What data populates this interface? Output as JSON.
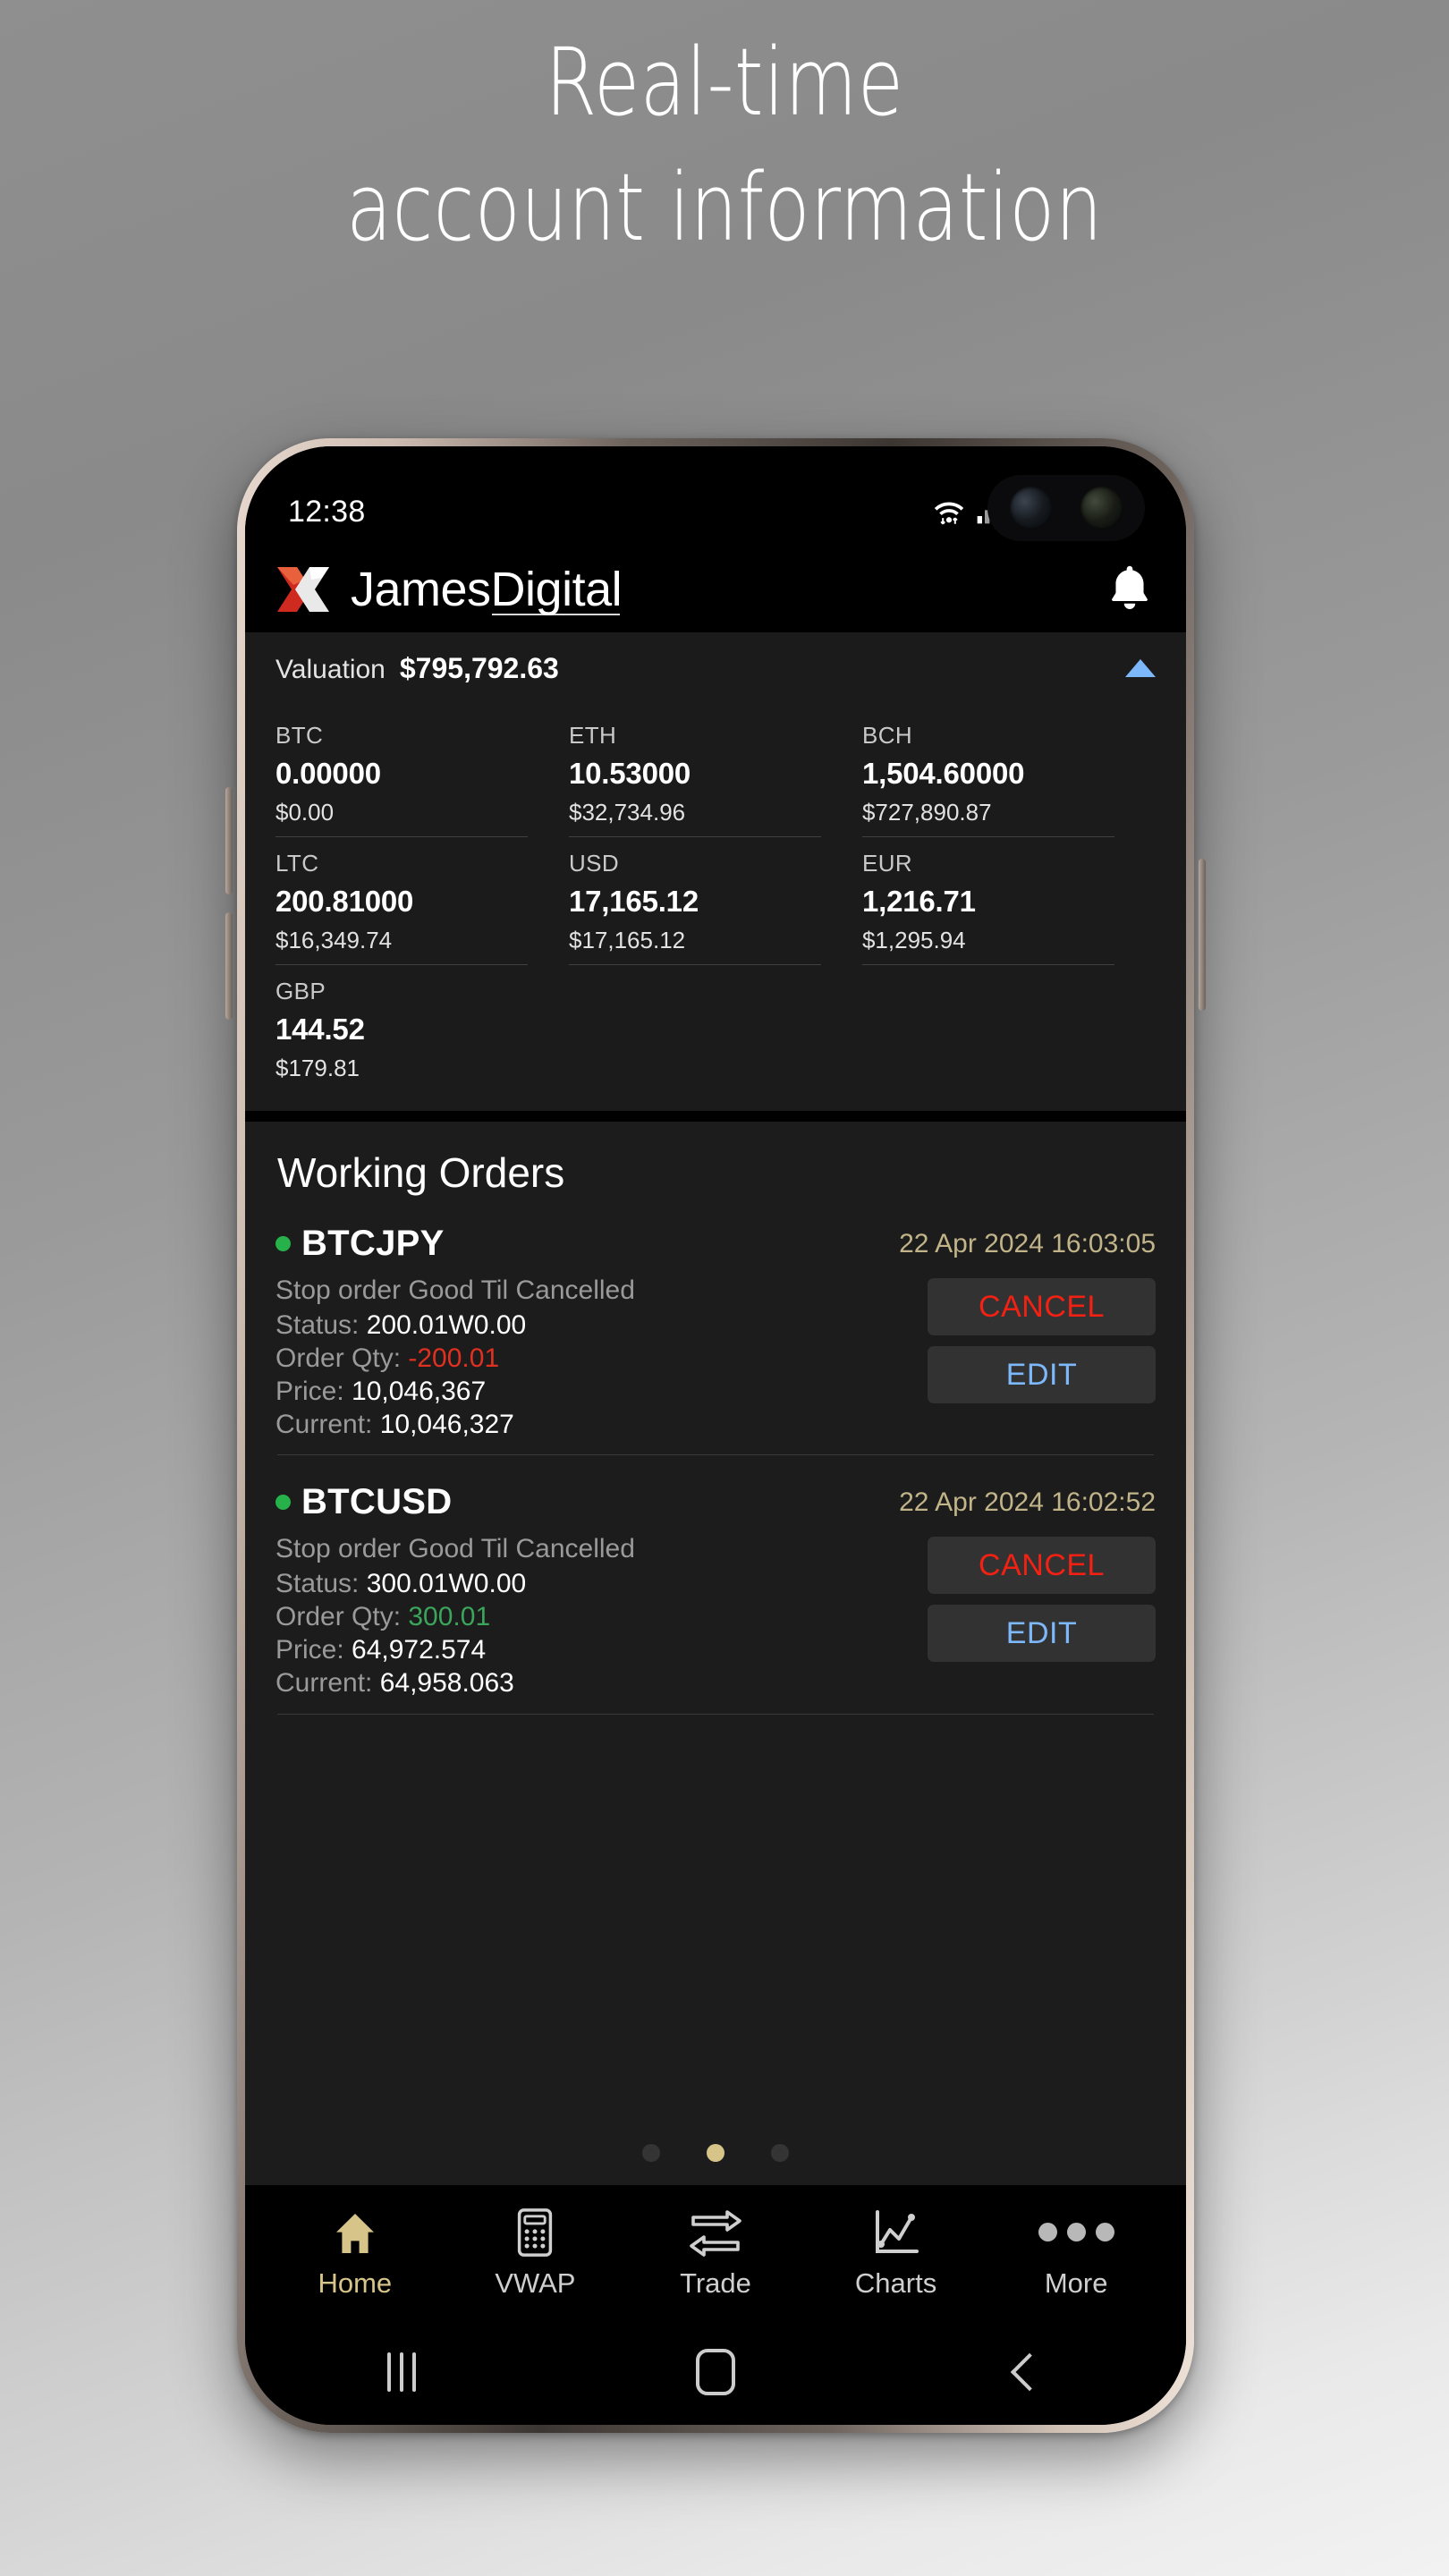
{
  "promo": {
    "line1": "Real-time",
    "line2": "account information"
  },
  "status_bar": {
    "time": "12:38",
    "icons": [
      "wifi-icon",
      "signal-icon",
      "battery-icon"
    ]
  },
  "app_header": {
    "brand": "JamesDigital",
    "logo": "x-logo",
    "notification_icon": "bell-icon"
  },
  "valuation": {
    "label": "Valuation",
    "amount": "$795,792.63",
    "trend": "up",
    "trend_color": "#7db8fb"
  },
  "balances": [
    {
      "currency": "BTC",
      "amount": "0.00000",
      "usd": "$0.00"
    },
    {
      "currency": "ETH",
      "amount": "10.53000",
      "usd": "$32,734.96"
    },
    {
      "currency": "BCH",
      "amount": "1,504.60000",
      "usd": "$727,890.87"
    },
    {
      "currency": "LTC",
      "amount": "200.81000",
      "usd": "$16,349.74"
    },
    {
      "currency": "USD",
      "amount": "17,165.12",
      "usd": "$17,165.12"
    },
    {
      "currency": "EUR",
      "amount": "1,216.71",
      "usd": "$1,295.94"
    },
    {
      "currency": "GBP",
      "amount": "144.52",
      "usd": "$179.81"
    }
  ],
  "orders_section": {
    "title": "Working Orders",
    "labels": {
      "status": "Status:",
      "qty": "Order Qty:",
      "price": "Price:",
      "current": "Current:"
    },
    "buttons": {
      "cancel": "CANCEL",
      "edit": "EDIT"
    },
    "items": [
      {
        "symbol": "BTCJPY",
        "timestamp": "22 Apr 2024 16:03:05",
        "description": "Stop order Good Til Cancelled",
        "status": "200.01W0.00",
        "qty": "-200.01",
        "qty_sign": "negative",
        "price": "10,046,367",
        "current": "10,046,327"
      },
      {
        "symbol": "BTCUSD",
        "timestamp": "22 Apr 2024 16:02:52",
        "description": "Stop order Good Til Cancelled",
        "status": "300.01W0.00",
        "qty": "300.01",
        "qty_sign": "positive",
        "price": "64,972.574",
        "current": "64,958.063"
      }
    ]
  },
  "pager": {
    "count": 3,
    "active_index": 1,
    "active_color": "#d6c488"
  },
  "tabbar": {
    "items": [
      {
        "label": "Home",
        "icon": "home-icon",
        "active": true
      },
      {
        "label": "VWAP",
        "icon": "calculator-icon",
        "active": false
      },
      {
        "label": "Trade",
        "icon": "exchange-arrows-icon",
        "active": false
      },
      {
        "label": "Charts",
        "icon": "line-chart-icon",
        "active": false
      },
      {
        "label": "More",
        "icon": "ellipsis-icon",
        "active": false
      }
    ]
  },
  "android_nav": {
    "recents": "recents-icon",
    "home": "home-square-icon",
    "back": "back-chevron-icon"
  },
  "colors": {
    "accent_gold": "#d6c488",
    "positive_green": "#3aa55b",
    "negative_red": "#e03020",
    "cancel_red": "#f32113",
    "edit_blue": "#7db8fb",
    "timestamp_tan": "#c2b489"
  }
}
